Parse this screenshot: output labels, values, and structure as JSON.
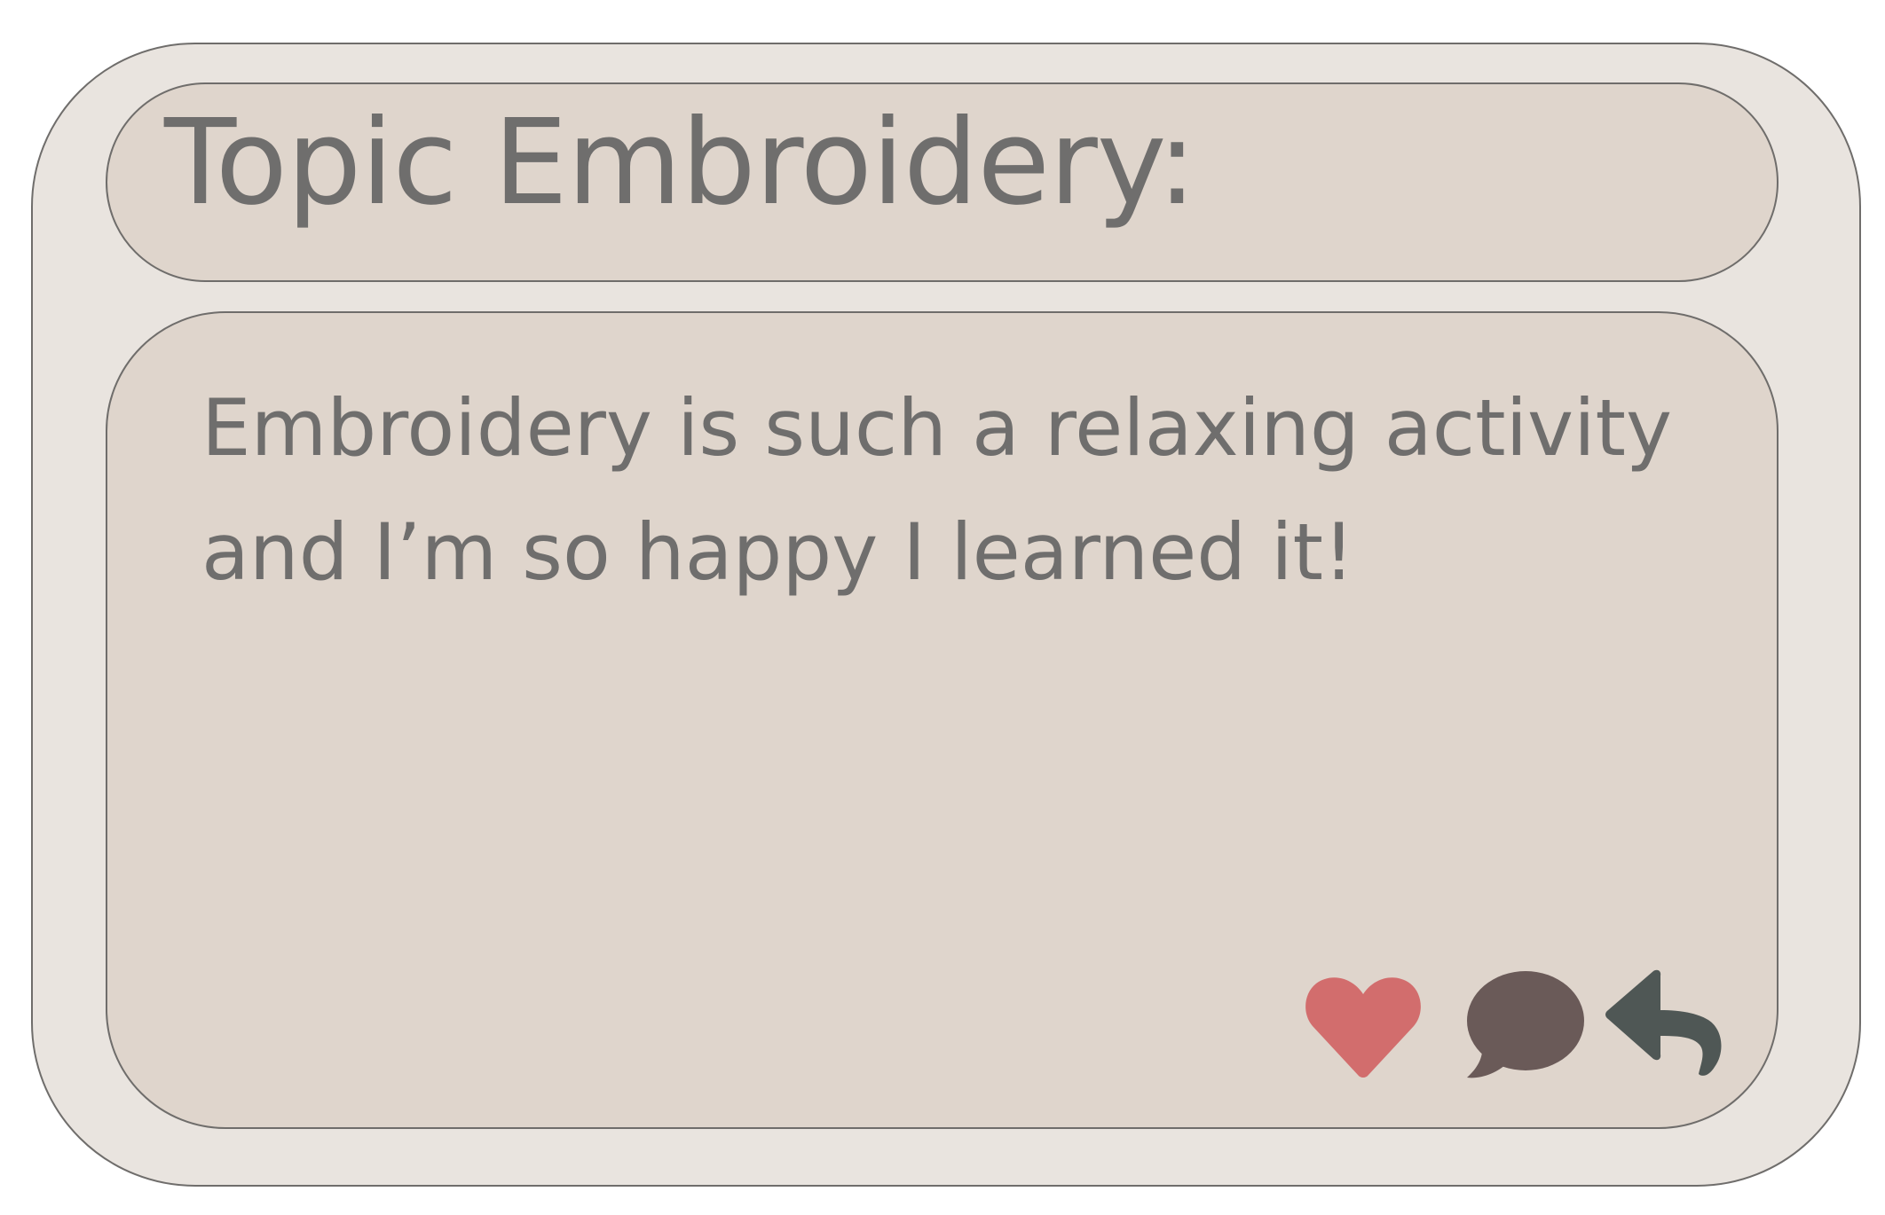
{
  "post": {
    "title": "Topic Embroidery:",
    "body": "Embroidery is such a relaxing activity and I’m so happy I learned it!"
  },
  "actions": [
    {
      "icon": "heart-icon",
      "color": "#d26d6d"
    },
    {
      "icon": "comment-icon",
      "color": "#6a5a58"
    },
    {
      "icon": "reply-icon",
      "color": "#4f5755"
    }
  ],
  "colors": {
    "outer_card": "#e9e4df",
    "inner_panel": "#dfd5cc",
    "border": "#6f6d6b",
    "text": "#6f6e6d"
  }
}
